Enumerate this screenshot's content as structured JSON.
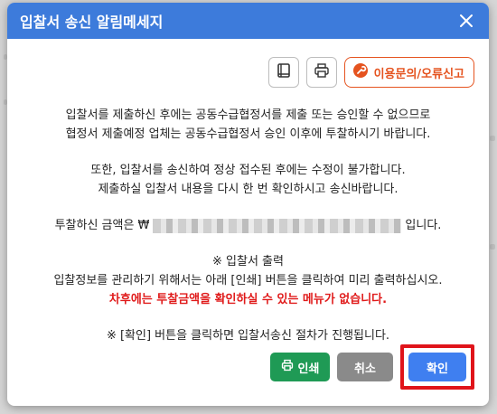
{
  "modal": {
    "title": "입찰서 송신 알림메세지",
    "close_icon": "close-icon"
  },
  "toolbar": {
    "manual_icon": "book-icon",
    "print_icon": "printer-icon",
    "inquiry_icon": "wrench-icon",
    "inquiry_label": "이용문의/오류신고"
  },
  "message": {
    "line1": "입찰서를 제출하신 후에는 공동수급협정서를 제출 또는 승인할 수 없으므로",
    "line2": "협정서 제출예정 업체는 공동수급협정서 승인 이후에 투찰하시기 바랍니다.",
    "line3": "또한, 입찰서를 송신하여 정상 접수된 후에는 수정이 불가합니다.",
    "line4": "제출하실 입찰서 내용을 다시 한 번 확인하시고 송신바랍니다.",
    "amount_prefix": "투찰하신 금액은 ₩",
    "amount_suffix": "입니다.",
    "print_heading": "※ 입찰서 출력",
    "print_instruction": "입찰정보를 관리하기 위해서는 아래 [인쇄] 버튼을 클릭하여 미리 출력하십시오.",
    "warning": "차후에는 투찰금액을 확인하실 수 있는 메뉴가 없습니다.",
    "confirm_note": "※ [확인] 버튼을 클릭하면 입찰서송신 절차가 진행됩니다."
  },
  "footer": {
    "print_label": "인쇄",
    "cancel_label": "취소",
    "confirm_label": "확인"
  },
  "colors": {
    "header": "#3d7bdb",
    "inquiry": "#e5531f",
    "warning": "#e01b1b",
    "print_button": "#1f9a55",
    "cancel_button": "#8a8a8a",
    "confirm_button": "#3f7ff0",
    "highlight_box": "#e0141a"
  }
}
